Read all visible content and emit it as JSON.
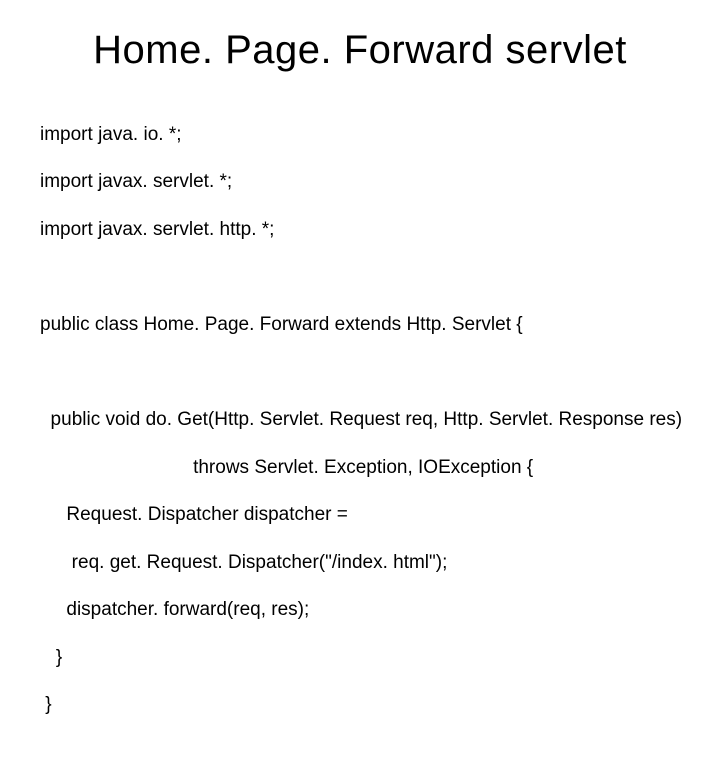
{
  "title": "Home. Page. Forward servlet",
  "code": {
    "l1": "import java. io. *;",
    "l2": "import javax. servlet. *;",
    "l3": "import javax. servlet. http. *;",
    "l4": "public class Home. Page. Forward extends Http. Servlet {",
    "l5": "  public void do. Get(Http. Servlet. Request req, Http. Servlet. Response res)",
    "l6": "                             throws Servlet. Exception, IOException {",
    "l7": "     Request. Dispatcher dispatcher =",
    "l8": "      req. get. Request. Dispatcher(\"/index. html\");",
    "l9": "     dispatcher. forward(req, res);",
    "l10": "   }",
    "l11": " }"
  }
}
